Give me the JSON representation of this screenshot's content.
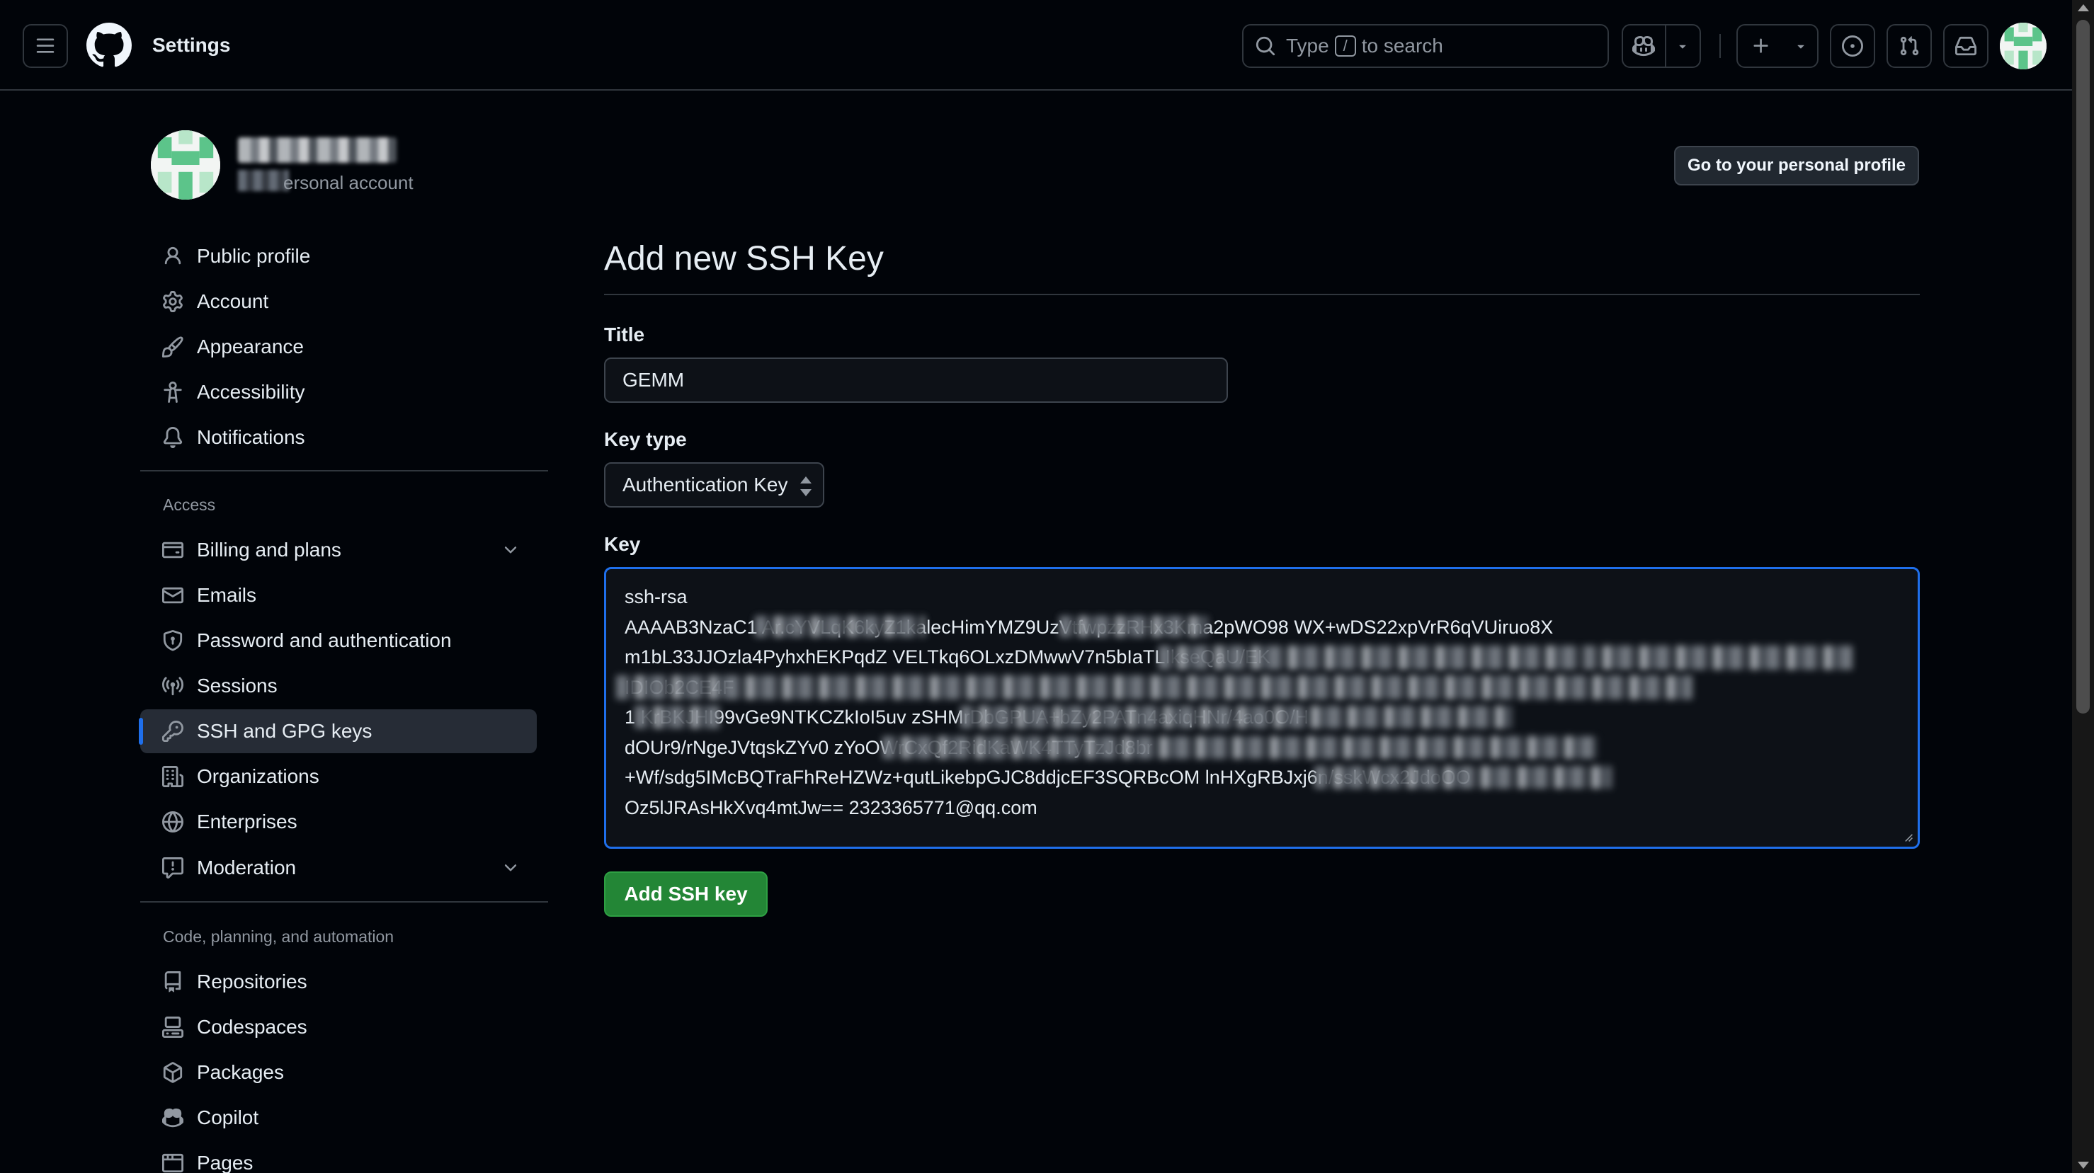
{
  "header": {
    "title": "Settings",
    "search": {
      "prefix": "Type",
      "key": "/",
      "suffix": "to search"
    }
  },
  "profile": {
    "account_suffix": "ersonal account",
    "go_to_profile_label": "Go to your personal profile"
  },
  "sidebar": {
    "items_top": [
      {
        "label": "Public profile",
        "icon": "person-icon"
      },
      {
        "label": "Account",
        "icon": "gear-icon"
      },
      {
        "label": "Appearance",
        "icon": "paintbrush-icon"
      },
      {
        "label": "Accessibility",
        "icon": "accessibility-icon"
      },
      {
        "label": "Notifications",
        "icon": "bell-icon"
      }
    ],
    "access_heading": "Access",
    "items_access": [
      {
        "label": "Billing and plans",
        "icon": "credit-card-icon",
        "expandable": true
      },
      {
        "label": "Emails",
        "icon": "mail-icon"
      },
      {
        "label": "Password and authentication",
        "icon": "shield-icon"
      },
      {
        "label": "Sessions",
        "icon": "broadcast-icon"
      },
      {
        "label": "SSH and GPG keys",
        "icon": "key-icon",
        "active": true
      },
      {
        "label": "Organizations",
        "icon": "organization-icon"
      },
      {
        "label": "Enterprises",
        "icon": "globe-icon"
      },
      {
        "label": "Moderation",
        "icon": "report-icon",
        "expandable": true
      }
    ],
    "code_heading": "Code, planning, and automation",
    "items_code": [
      {
        "label": "Repositories",
        "icon": "repo-icon"
      },
      {
        "label": "Codespaces",
        "icon": "codespaces-icon"
      },
      {
        "label": "Packages",
        "icon": "package-icon"
      },
      {
        "label": "Copilot",
        "icon": "copilot-icon"
      },
      {
        "label": "Pages",
        "icon": "browser-icon"
      }
    ]
  },
  "form": {
    "page_title": "Add new SSH Key",
    "title_label": "Title",
    "title_value": "GEMM",
    "key_type_label": "Key type",
    "key_type_value": "Authentication Key",
    "key_label": "Key",
    "key_lines": [
      "ssh-rsa",
      "AAAAB3NzaC1                                                                        Ar.cYVLqK6kyZ1kalecHimYMZ9UzVtfwpzzRHx3Kma2pWO98    WX+wDS22xpVrR6qVUiruo8X",
      "m1bL33JJOzla4PyhxhEKPqdZ                                                                                                                          VELTkq6OLxzDMwwV7n5bIaTLIkseQaU/EK",
      "                                                                                                                                                                         IDIOb2CE4F",
      "1                 KrBKJHI99vGe9NTKCZkIoI5uv                                                                              zSHMrDbGPUA+bZy2PATn4axiqHNr/4ao0O/H",
      "dOUr9/rNgeJVtqskZYv0                                                                                                                          zYoOWrCxQf2RidKaWK4TTyTzJd8br",
      "+Wf/sdg5IMcBQTraFhReHZWz+qutLikebpGJC8ddjcEF3SQRBcOM                                                                 lnHXgRBJxj6n/sskWcx2JdoOO",
      "Oz5lJRAsHkXvq4mtJw== 2323365771@qq.com"
    ],
    "submit_label": "Add SSH key"
  },
  "colors": {
    "accent": "#1f6feb",
    "primary_button": "#238636",
    "background": "#010409"
  }
}
